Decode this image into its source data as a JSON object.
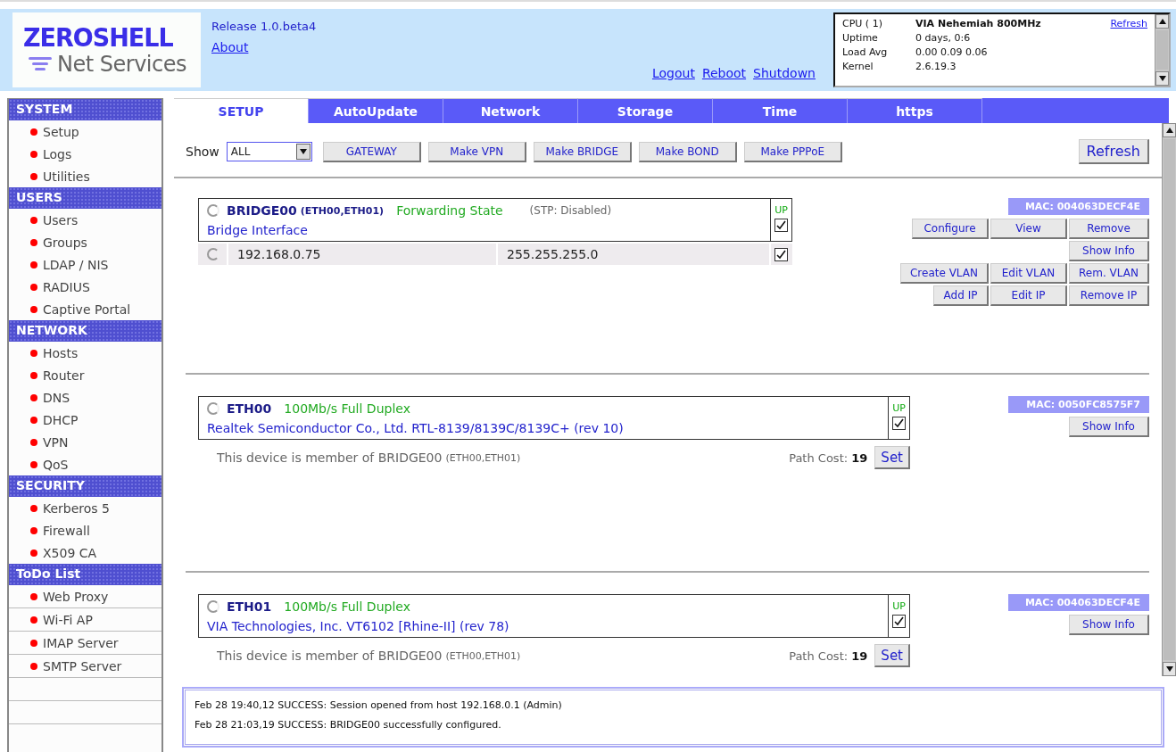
{
  "header": {
    "logo": {
      "title": "ZEROSHELL",
      "subtitle": "Net Services"
    },
    "release": "Release 1.0.beta4",
    "about": "About",
    "links": [
      "Logout",
      "Reboot",
      "Shutdown"
    ],
    "sysinfo": {
      "rows": [
        {
          "label": "CPU ( 1)",
          "value": "VIA Nehemiah 800MHz",
          "bold": true
        },
        {
          "label": "Uptime",
          "value": "0 days, 0:6",
          "bold": false
        },
        {
          "label": "Load Avg",
          "value": "0.00 0.09 0.06",
          "bold": false
        },
        {
          "label": "Kernel",
          "value": "2.6.19.3",
          "bold": false
        }
      ],
      "refresh": "Refresh"
    }
  },
  "sidebar": {
    "sections": [
      {
        "title": "SYSTEM",
        "ruled": false,
        "items": [
          "Setup",
          "Logs",
          "Utilities"
        ]
      },
      {
        "title": "USERS",
        "ruled": false,
        "items": [
          "Users",
          "Groups",
          "LDAP / NIS",
          "RADIUS",
          "Captive Portal"
        ]
      },
      {
        "title": "NETWORK",
        "ruled": false,
        "items": [
          "Hosts",
          "Router",
          "DNS",
          "DHCP",
          "VPN",
          "QoS"
        ]
      },
      {
        "title": "SECURITY",
        "ruled": false,
        "items": [
          "Kerberos 5",
          "Firewall",
          "X509 CA"
        ]
      },
      {
        "title": "ToDo List",
        "ruled": true,
        "items": [
          "Web Proxy",
          "Wi-Fi AP",
          "IMAP Server",
          "SMTP Server"
        ]
      }
    ]
  },
  "tabs": [
    {
      "label": "SETUP",
      "selected": true
    },
    {
      "label": "AutoUpdate",
      "selected": false
    },
    {
      "label": "Network",
      "selected": false
    },
    {
      "label": "Storage",
      "selected": false
    },
    {
      "label": "Time",
      "selected": false
    },
    {
      "label": "https",
      "selected": false
    }
  ],
  "toolbar": {
    "show_label": "Show",
    "show_value": "ALL",
    "buttons": [
      "GATEWAY",
      "Make VPN",
      "Make BRIDGE",
      "Make BOND",
      "Make PPPoE"
    ],
    "refresh": "Refresh"
  },
  "interfaces": [
    {
      "kind": "bridge",
      "selected": false,
      "name": "BRIDGE00",
      "members": "(ETH00,ETH01)",
      "state": "Forwarding State",
      "stp": "(STP: Disabled)",
      "description": "Bridge Interface",
      "up_label": "UP",
      "up": true,
      "addresses": [
        {
          "ip": "192.168.0.75",
          "mask": "255.255.255.0",
          "checked": true,
          "selected": false
        }
      ],
      "mac": "MAC: 004063DECF4E",
      "actions": [
        [
          "Configure",
          "View",
          "Remove"
        ],
        [
          "Show Info"
        ],
        [
          "Create VLAN",
          "Edit VLAN",
          "Rem. VLAN"
        ],
        [
          "Add IP",
          "Edit IP",
          "Remove IP"
        ]
      ]
    },
    {
      "kind": "ethernet",
      "selected": false,
      "name": "ETH00",
      "state": "100Mb/s Full Duplex",
      "description": "Realtek Semiconductor Co., Ltd. RTL-8139/8139C/8139C+ (rev 10)",
      "up_label": "UP",
      "up": true,
      "member_text": "This device is member of BRIDGE00",
      "members": "(ETH00,ETH01)",
      "path_cost_label": "Path Cost:",
      "path_cost": "19",
      "set": "Set",
      "mac": "MAC: 0050FC8575F7",
      "actions": [
        [
          "Show Info"
        ]
      ]
    },
    {
      "kind": "ethernet",
      "selected": false,
      "name": "ETH01",
      "state": "100Mb/s Full Duplex",
      "description": "VIA Technologies, Inc. VT6102 [Rhine-II] (rev 78)",
      "up_label": "UP",
      "up": true,
      "member_text": "This device is member of BRIDGE00",
      "members": "(ETH00,ETH01)",
      "path_cost_label": "Path Cost:",
      "path_cost": "19",
      "set": "Set",
      "mac": "MAC: 004063DECF4E",
      "actions": [
        [
          "Show Info"
        ]
      ]
    }
  ],
  "log": [
    "Feb 28 19:40,12 SUCCESS: Session opened from host 192.168.0.1 (Admin)",
    "Feb 28 21:03,19 SUCCESS: BRIDGE00 successfully configured."
  ]
}
